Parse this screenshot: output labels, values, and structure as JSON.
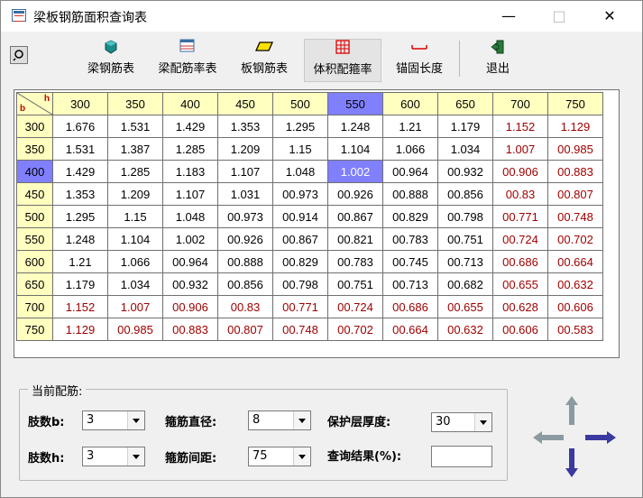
{
  "window": {
    "title": "梁板钢筋面积查询表",
    "minimize": "—",
    "maximize": "□",
    "close": "✕"
  },
  "toolbar": {
    "left_icon": "pin-icon",
    "buttons": [
      {
        "label": "梁钢筋表",
        "icon": "box-icon"
      },
      {
        "label": "梁配筋率表",
        "icon": "table-icon"
      },
      {
        "label": "板钢筋表",
        "icon": "plate-icon"
      },
      {
        "label": "体积配箍率",
        "icon": "grid-icon"
      },
      {
        "label": "锚固长度",
        "icon": "anchor-icon"
      },
      {
        "label": "退出",
        "icon": "exit-icon"
      }
    ]
  },
  "table": {
    "corner_b": "b",
    "corner_h": "h",
    "col_headers": [
      "300",
      "350",
      "400",
      "450",
      "500",
      "550",
      "600",
      "650",
      "700",
      "750"
    ],
    "selected_col": 5,
    "selected_row": 2,
    "rows": [
      {
        "h": "300",
        "cells": [
          "1.676",
          "1.531",
          "1.429",
          "1.353",
          "1.295",
          "1.248",
          "1.21",
          "1.179",
          "1.152",
          "1.129"
        ]
      },
      {
        "h": "350",
        "cells": [
          "1.531",
          "1.387",
          "1.285",
          "1.209",
          "1.15",
          "1.104",
          "1.066",
          "1.034",
          "1.007",
          "00.985"
        ]
      },
      {
        "h": "400",
        "cells": [
          "1.429",
          "1.285",
          "1.183",
          "1.107",
          "1.048",
          "1.002",
          "00.964",
          "00.932",
          "00.906",
          "00.883"
        ]
      },
      {
        "h": "450",
        "cells": [
          "1.353",
          "1.209",
          "1.107",
          "1.031",
          "00.973",
          "00.926",
          "00.888",
          "00.856",
          "00.83",
          "00.807"
        ]
      },
      {
        "h": "500",
        "cells": [
          "1.295",
          "1.15",
          "1.048",
          "00.973",
          "00.914",
          "00.867",
          "00.829",
          "00.798",
          "00.771",
          "00.748"
        ]
      },
      {
        "h": "550",
        "cells": [
          "1.248",
          "1.104",
          "1.002",
          "00.926",
          "00.867",
          "00.821",
          "00.783",
          "00.751",
          "00.724",
          "00.702"
        ]
      },
      {
        "h": "600",
        "cells": [
          "1.21",
          "1.066",
          "00.964",
          "00.888",
          "00.829",
          "00.783",
          "00.745",
          "00.713",
          "00.686",
          "00.664"
        ]
      },
      {
        "h": "650",
        "cells": [
          "1.179",
          "1.034",
          "00.932",
          "00.856",
          "00.798",
          "00.751",
          "00.713",
          "00.682",
          "00.655",
          "00.632"
        ]
      },
      {
        "h": "700",
        "cells": [
          "1.152",
          "1.007",
          "00.906",
          "00.83",
          "00.771",
          "00.724",
          "00.686",
          "00.655",
          "00.628",
          "00.606"
        ]
      },
      {
        "h": "750",
        "cells": [
          "1.129",
          "00.985",
          "00.883",
          "00.807",
          "00.748",
          "00.702",
          "00.664",
          "00.632",
          "00.606",
          "00.583"
        ]
      }
    ],
    "red_color": "#a00000",
    "header_color": "#ffffc0",
    "selected_color": "#8080ff"
  },
  "config": {
    "group_title": "当前配筋:",
    "legs_b_label": "肢数b:",
    "legs_b_value": "3",
    "legs_h_label": "肢数h:",
    "legs_h_value": "3",
    "stirrup_dia_label": "箍筋直径:",
    "stirrup_dia_value": "8",
    "stirrup_spacing_label": "箍筋间距:",
    "stirrup_spacing_value": "75",
    "cover_label": "保护层厚度:",
    "cover_value": "30",
    "result_label": "查询结果(%):",
    "result_value": ""
  },
  "nav": {
    "up": "arrow-up-icon",
    "down": "arrow-down-icon",
    "left": "arrow-left-icon",
    "right": "arrow-right-icon"
  }
}
